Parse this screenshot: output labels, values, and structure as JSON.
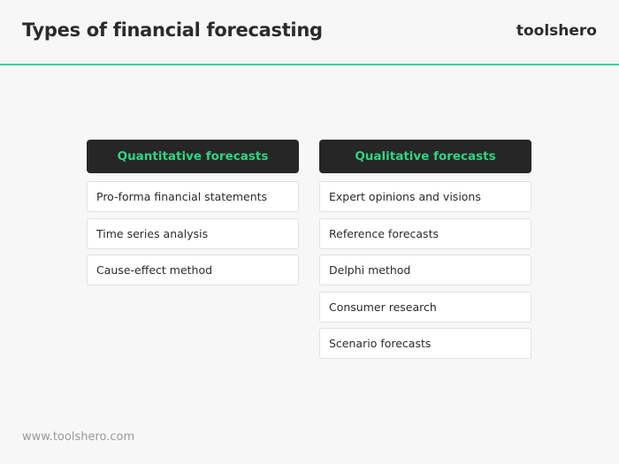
{
  "header": {
    "title": "Types of financial forecasting",
    "brand": "toolshero"
  },
  "columns": [
    {
      "heading": "Quantitative forecasts",
      "items": [
        "Pro-forma financial statements",
        "Time series analysis",
        "Cause-effect method"
      ]
    },
    {
      "heading": "Qualitative forecasts",
      "items": [
        "Expert opinions and visions",
        "Reference forecasts",
        "Delphi method",
        "Consumer research",
        "Scenario forecasts"
      ]
    }
  ],
  "footer": {
    "url": "www.toolshero.com"
  },
  "colors": {
    "accent": "#3fcf9e",
    "heading_text": "#2fd47f",
    "heading_bg": "#262626"
  }
}
